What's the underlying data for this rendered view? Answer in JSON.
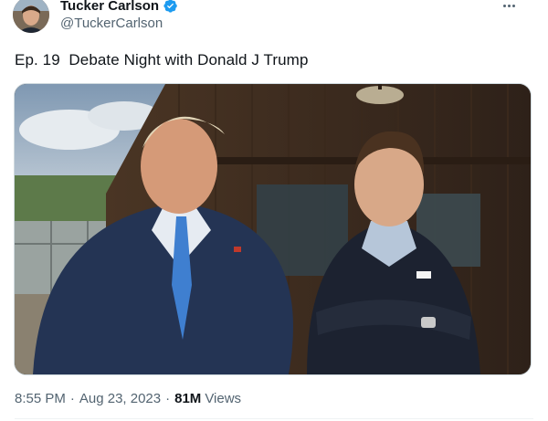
{
  "author": {
    "display_name": "Tucker Carlson",
    "handle": "@TuckerCarlson",
    "verified": true
  },
  "tweet": {
    "text": "Ep. 19  Debate Night with Donald J Trump"
  },
  "meta": {
    "time": "8:55 PM",
    "separator": "·",
    "date": "Aug 23, 2023",
    "views_count": "81M",
    "views_label": "Views"
  },
  "colors": {
    "verified_blue": "#1d9bf0",
    "secondary_text": "#536471",
    "primary_text": "#0f1419"
  },
  "icons": {
    "verified": "verified-badge-icon",
    "more": "more-options-icon"
  }
}
